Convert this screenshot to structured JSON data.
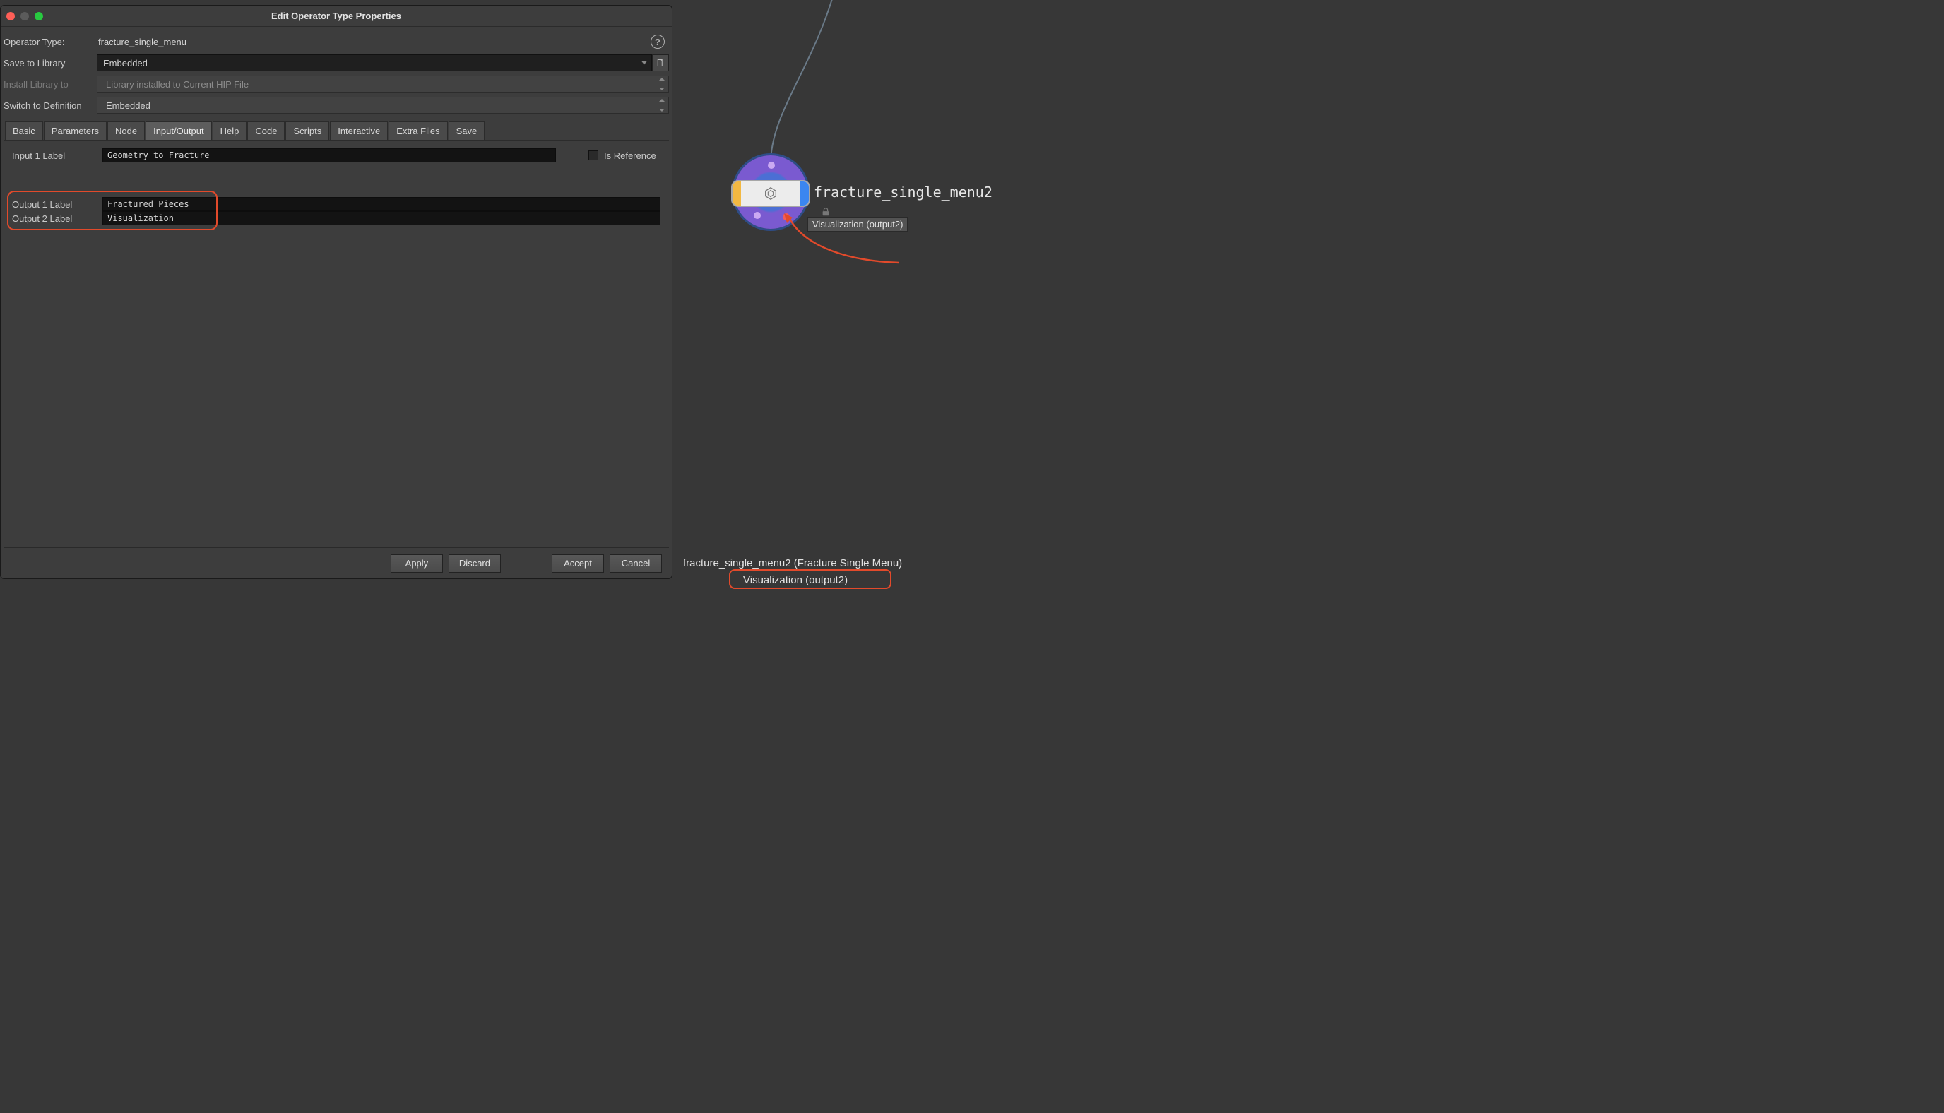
{
  "window_title": "Edit Operator Type Properties",
  "operator_type_label": "Operator Type:",
  "operator_type_value": "fracture_single_menu",
  "save_to_library_label": "Save to Library",
  "save_to_library_value": "Embedded",
  "install_library_label": "Install Library to",
  "install_library_value": "Library installed to Current HIP File",
  "switch_def_label": "Switch to Definition",
  "switch_def_value": "Embedded",
  "tabs": {
    "basic": "Basic",
    "parameters": "Parameters",
    "node": "Node",
    "io": "Input/Output",
    "help": "Help",
    "code": "Code",
    "scripts": "Scripts",
    "interactive": "Interactive",
    "extra": "Extra Files",
    "save": "Save"
  },
  "input1_label": "Input 1 Label",
  "input1_value": "Geometry to Fracture",
  "is_reference_label": "Is Reference",
  "output1_label": "Output 1 Label",
  "output1_value": "Fractured Pieces",
  "output2_label": "Output 2 Label",
  "output2_value": "Visualization",
  "buttons": {
    "apply": "Apply",
    "discard": "Discard",
    "accept": "Accept",
    "cancel": "Cancel"
  },
  "node": {
    "label": "fracture_single_menu2",
    "tooltip": "Visualization (output2)"
  },
  "status_line1": "fracture_single_menu2 (Fracture Single Menu)",
  "status_line2": "Visualization (output2)"
}
